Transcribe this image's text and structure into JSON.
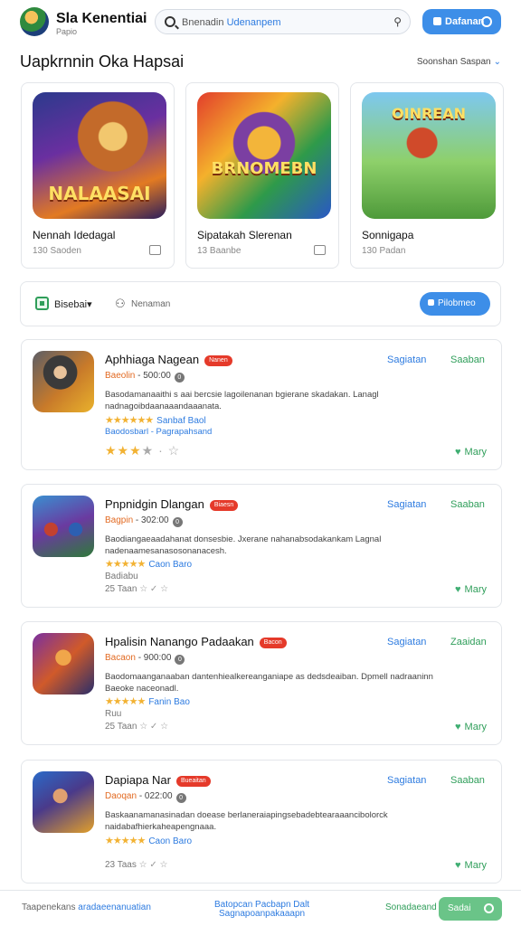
{
  "header": {
    "brand": "Sla Kenentiai",
    "brand_sub": "Papio",
    "search_prefix": "Bnenadin",
    "search_highlight": "Udenanpem",
    "top_button": "Dafanan"
  },
  "section": {
    "title": "Uapkrnnin Oka Hapsai",
    "link": "Soonshan Saspan"
  },
  "featured": [
    {
      "name": "Nennah Idedagal",
      "meta": "130 Saoden",
      "art_text": "NALAASAI",
      "icon": "image-icon"
    },
    {
      "name": "Sipatakah Slerenan",
      "meta": "13 Baanbe",
      "art_text": "BRNOMEBN",
      "icon": "image-icon"
    },
    {
      "name": "Sonnigapa",
      "meta": "130 Padan",
      "art_text": "OINREAN",
      "icon": "image-icon"
    }
  ],
  "filter": {
    "category": "Bisebai",
    "sort": "Nenaman",
    "button": "Pilobmeo"
  },
  "apps": [
    {
      "title": "Aphhiaga Nagean",
      "badge": "Nanen",
      "sub_orange": "Baeolin",
      "sub_rest": "- 500:00",
      "sub_count": "0",
      "desc": "Basodamanaaithi s aai bercsie lagoilenanan bgierane skadakan. Lanagl nadnagoibdaanaaandaaanata.",
      "stars_label": "Sanbaf Baol",
      "link": "Baodosbarl - Pagrapahsand",
      "rating_on": 3,
      "rating_off": 2,
      "act1": "Sagiatan",
      "act2": "Saaban",
      "more": "Mary"
    },
    {
      "title": "Pnpnidgin Dlangan",
      "badge": "Biaesn",
      "sub_orange": "Bagpin",
      "sub_rest": "- 302:00",
      "sub_count": "0",
      "desc": "Baodiangaeaadahanat donsesbie. Jxerane nahanabsodakankam Lagnal nadenaamesanasosonanacesh.",
      "stars_label": "Caon Baro",
      "link": "Badiabu",
      "meta_time": "25 Taan",
      "rating_on": 0,
      "rating_off": 2,
      "act1": "Sagiatan",
      "act2": "Saaban",
      "more": "Mary"
    },
    {
      "title": "Hpalisin Nanango Padaakan",
      "badge": "Bacon",
      "sub_orange": "Bacaon",
      "sub_rest": "- 900:00",
      "sub_count": "0",
      "desc": "Baodomaanganaaban dantenhiealkereanganiape as dedsdeaiban. Dpmell nadraaninn Baeoke naceonadl.",
      "stars_label": "Fanin Bao",
      "link": "Ruu",
      "meta_time": "25 Taan",
      "rating_on": 0,
      "rating_off": 2,
      "act1": "Sagiatan",
      "act2": "Zaaidan",
      "more": "Mary"
    },
    {
      "title": "Dapiapa Nar",
      "badge": "Bueaitan",
      "sub_orange": "Daoqan",
      "sub_rest": "- 022:00",
      "sub_count": "0",
      "desc": "Baskaanamanasinadan doease berlaneraiapingsebadebtearaaancibolorck naidabafhierkaheapengnaaa.",
      "stars_label": "Caon Baro",
      "meta_time": "23 Taas",
      "rating_on": 0,
      "rating_off": 2,
      "act1": "Sagiatan",
      "act2": "Saaban",
      "more": "Mary"
    }
  ],
  "bottom": {
    "left_text": "Taapenekans",
    "left_highlight": "aradaeenanuatian",
    "center_line1": "Batopcan Pacbapn Dalt",
    "center_line2": "Sagnapoanpakaaapn",
    "right_text": "Sonadaeand",
    "right_button": "Sadai"
  },
  "colors": {
    "accent_blue": "#3d8ee8",
    "accent_green": "#2f9e5a",
    "badge_red": "#e53a2a",
    "star_yellow": "#f2b233"
  }
}
